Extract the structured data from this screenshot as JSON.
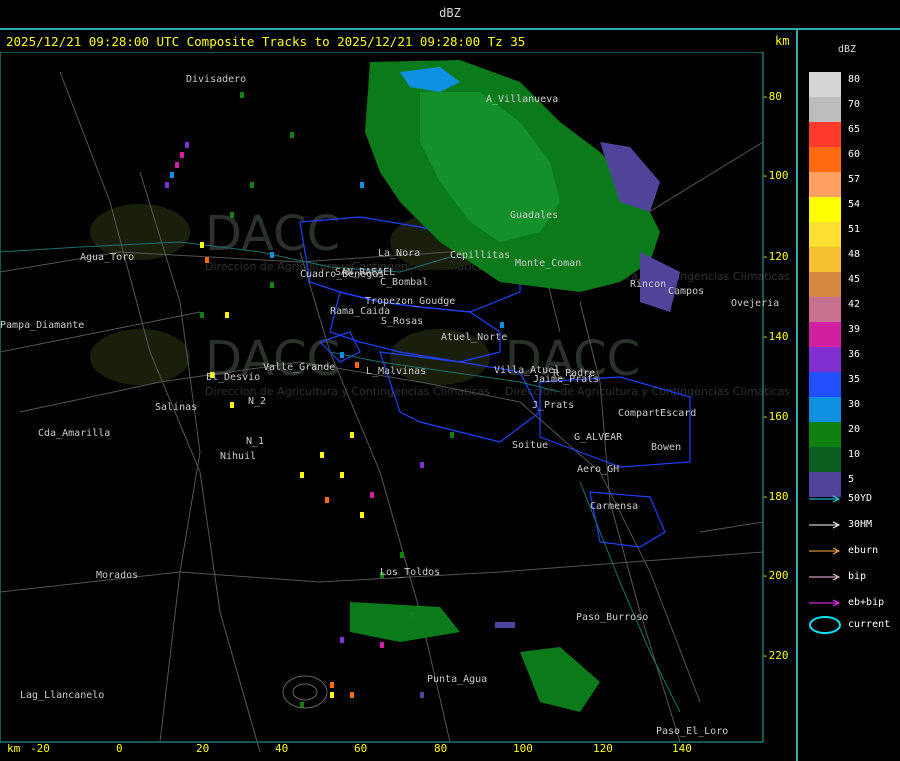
{
  "window": {
    "title": "dBZ"
  },
  "header": {
    "text": "2025/12/21 09:28:00 UTC Composite Tracks to 2025/12/21 09:28:00 Tz 35",
    "km_label": "km"
  },
  "legend": {
    "title": "dBZ",
    "levels": [
      {
        "label": "80",
        "color": "#d6d6d6"
      },
      {
        "label": "70",
        "color": "#bdbdbd"
      },
      {
        "label": "65",
        "color": "#ff3a2a"
      },
      {
        "label": "60",
        "color": "#ff6a10"
      },
      {
        "label": "57",
        "color": "#ffa060"
      },
      {
        "label": "54",
        "color": "#ffff00"
      },
      {
        "label": "51",
        "color": "#ffe030"
      },
      {
        "label": "48",
        "color": "#f5c030"
      },
      {
        "label": "45",
        "color": "#d48840"
      },
      {
        "label": "42",
        "color": "#c87090"
      },
      {
        "label": "39",
        "color": "#d020a0"
      },
      {
        "label": "36",
        "color": "#8030d0"
      },
      {
        "label": "35",
        "color": "#2050ff"
      },
      {
        "label": "30",
        "color": "#1090e0"
      },
      {
        "label": "20",
        "color": "#108010"
      },
      {
        "label": "10",
        "color": "#0a6020"
      },
      {
        "label": "5",
        "color": "#50449a"
      }
    ],
    "tracks": [
      {
        "label": "50YD",
        "color": "#20e0ff"
      },
      {
        "label": "30HM",
        "color": "#ffffff"
      },
      {
        "label": "eburn",
        "color": "#ffb040"
      },
      {
        "label": "bip",
        "color": "#ffc0e0"
      },
      {
        "label": "eb+bip",
        "color": "#ff30ff"
      }
    ],
    "current_label": "current"
  },
  "axes": {
    "x_label": "km",
    "x_ticks": [
      "-20",
      "0",
      "20",
      "40",
      "60",
      "80",
      "100",
      "120",
      "140"
    ],
    "y_ticks": [
      "-80",
      "-100",
      "-120",
      "-140",
      "-160",
      "-180",
      "-200",
      "-220"
    ]
  },
  "places": [
    {
      "name": "Divisadero"
    },
    {
      "name": "A_Villanueva"
    },
    {
      "name": "Guadales"
    },
    {
      "name": "Monte_Coman"
    },
    {
      "name": "La_Nora"
    },
    {
      "name": "Cepillitas"
    },
    {
      "name": "Rama_Caida"
    },
    {
      "name": "Cuadro_Benegas"
    },
    {
      "name": "SAN_RAFAEL"
    },
    {
      "name": "Atuel_Norte"
    },
    {
      "name": "Villa_Atuel"
    },
    {
      "name": "Salinas"
    },
    {
      "name": "Nihuil"
    },
    {
      "name": "Morados"
    },
    {
      "name": "Punta_Agua"
    },
    {
      "name": "Paso_Burroso"
    },
    {
      "name": "Paso_El_Loro"
    },
    {
      "name": "Carmensa"
    },
    {
      "name": "Bowen"
    },
    {
      "name": "Lag_Llancanelo"
    },
    {
      "name": "Soitue"
    },
    {
      "name": "Agua_Toro"
    },
    {
      "name": "Pampa_Diamante"
    },
    {
      "name": "Cda_Amarilla"
    },
    {
      "name": "G_ALVEAR"
    },
    {
      "name": "CompartEscard"
    },
    {
      "name": "Ovejeria"
    },
    {
      "name": "Campos"
    },
    {
      "name": "L_Malvinas"
    },
    {
      "name": "S_Rosas"
    },
    {
      "name": "El_Desvio"
    },
    {
      "name": "Valle_Grande"
    },
    {
      "name": "Los_Toldos"
    },
    {
      "name": "Aero_GH"
    },
    {
      "name": "R_Padre"
    },
    {
      "name": "J_Prats"
    },
    {
      "name": "C_Bombal"
    },
    {
      "name": "Tropezon_Goudge"
    },
    {
      "name": "N_1"
    },
    {
      "name": "N_2"
    },
    {
      "name": "Jaime_Prats"
    },
    {
      "name": "Rincon"
    }
  ],
  "watermark": {
    "text": "DACC",
    "sub": "Direccion de Agricultura y Contingencias Climaticas"
  }
}
